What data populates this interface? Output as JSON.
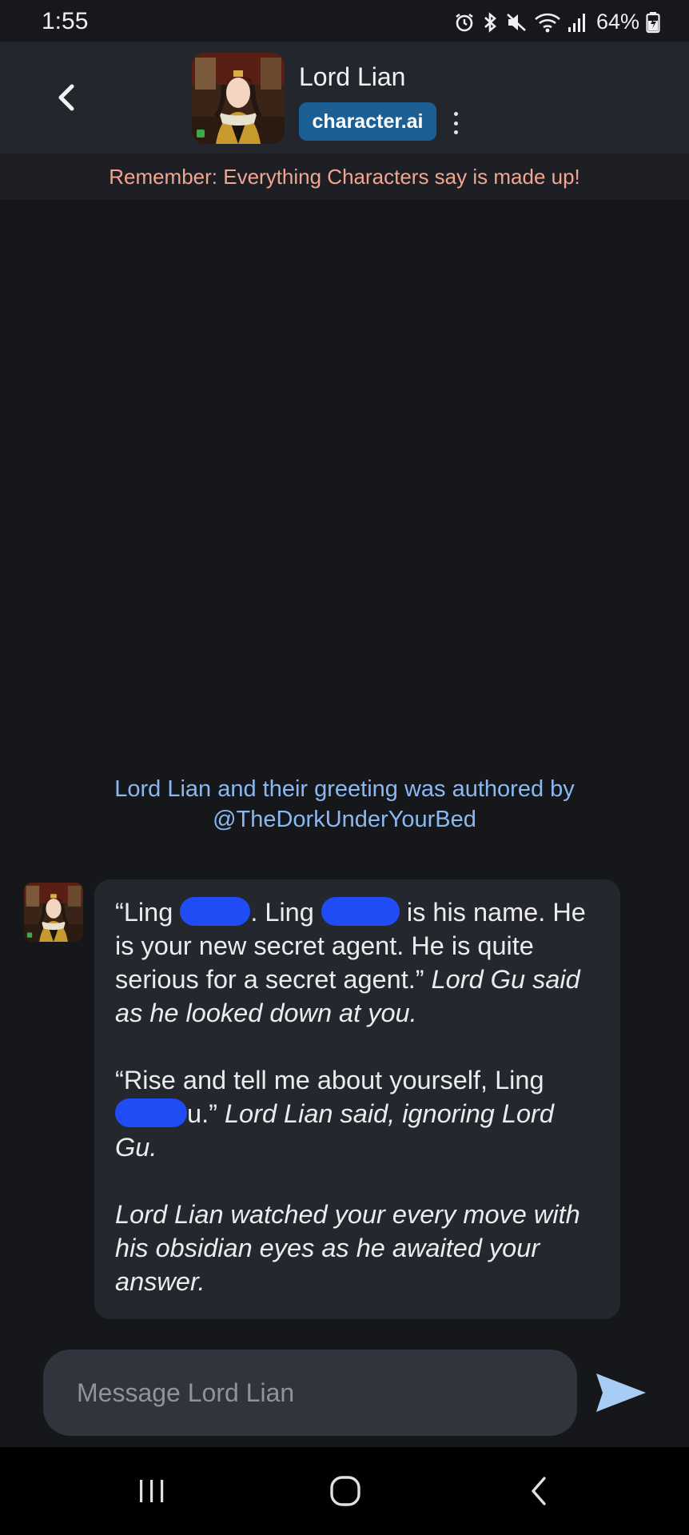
{
  "status_bar": {
    "time": "1:55",
    "battery_percent": "64%",
    "icons": [
      "alarm-icon",
      "bluetooth-icon",
      "mute-icon",
      "wifi-icon",
      "signal-icon",
      "battery-icon"
    ]
  },
  "header": {
    "character_name": "Lord Lian",
    "brand": "character.ai",
    "back_icon": "chevron-left-icon",
    "more_icon": "more-vertical-icon"
  },
  "disclaimer": "Remember: Everything Characters say is made up!",
  "attribution": {
    "line1": "Lord Lian and their greeting was authored by",
    "line2": "@TheDorkUnderYourBed"
  },
  "message": {
    "p1_t1": "“Ling ",
    "p1_t2": ". Ling ",
    "p1_t3": " is his name. He is your new secret agent. He is quite serious for a secret agent.” ",
    "p1_em": "Lord Gu said as he looked down at you.",
    "p2_t1": "“Rise and tell me about yourself, Ling ",
    "p2_t2": "u.” ",
    "p2_em": "Lord Lian said, ignoring Lord Gu.",
    "p3_em": "Lord Lian watched your every move with his obsidian eyes as he awaited your answer."
  },
  "composer": {
    "placeholder": "Message Lord Lian",
    "value": "",
    "send_icon": "send-icon"
  },
  "nav_bar": {
    "icons": [
      "recents-icon",
      "home-icon",
      "back-icon"
    ]
  },
  "colors": {
    "background": "#16171b",
    "header": "#24262d",
    "brand_badge": "#1b5f95",
    "disclaimer_text": "#f2a58f",
    "attribution_text": "#8ab8f2",
    "bubble": "#25272e",
    "send_arrow": "#a8cdf5",
    "redaction": "#1f4cf5"
  }
}
